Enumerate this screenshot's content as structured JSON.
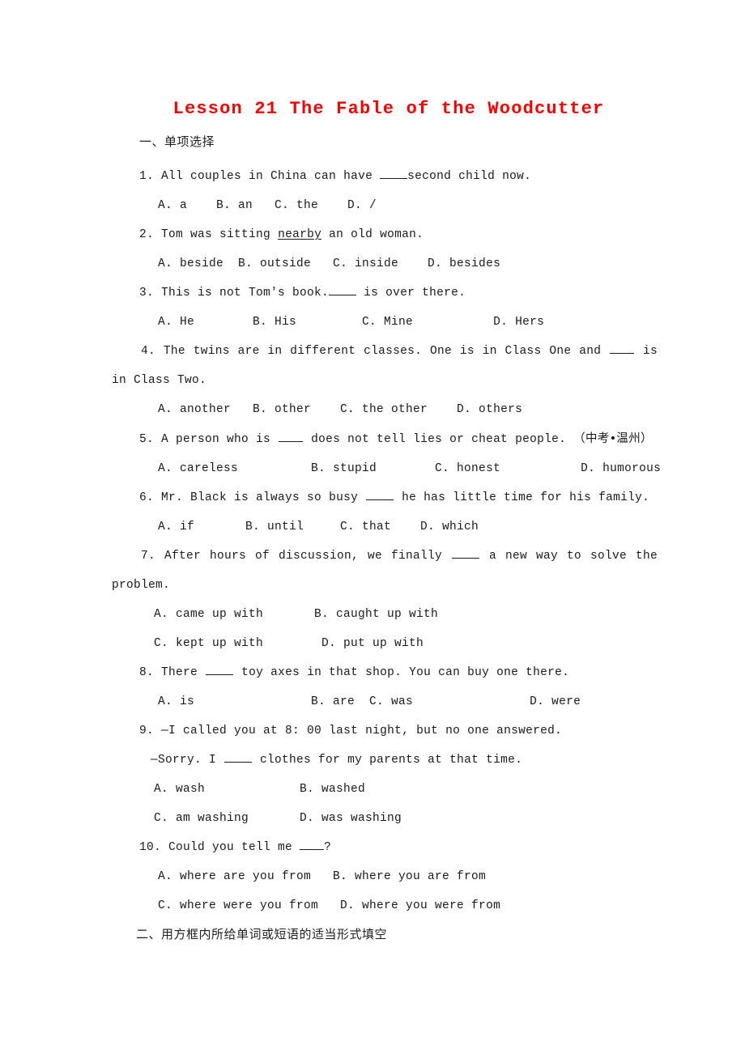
{
  "document": {
    "title": "Lesson 21 The Fable of the Woodcutter",
    "title_color": "#FF0000",
    "background_color": "#FFFFFF",
    "text_color": "#1A1A1A"
  },
  "sections": [
    {
      "id": "section-one",
      "heading": "一、单项选择"
    },
    {
      "id": "section-two",
      "heading": "二、用方框内所给单词或短语的适当形式填空"
    }
  ],
  "questions": [
    {
      "number": "1.",
      "stem_before": "All couples in China can have",
      "stem_after": "second child now.",
      "options_line1": "A. a    B. an   C. the    D. /",
      "options_line2": ""
    },
    {
      "number": "2.",
      "stem_before": "Tom was sitting",
      "underlined_word": "nearby",
      "stem_after": "an old woman.",
      "options_line1": "A. beside  B. outside   C. inside    D. besides",
      "options_line2": ""
    },
    {
      "number": "3.",
      "stem_before": "This is not Tom's book.",
      "stem_after": "is over there.",
      "options_line1": "A. He        B. His         C. Mine           D. Hers",
      "options_line2": ""
    },
    {
      "number": "4.",
      "stem_before": "The twins are in different classes. One is in Class One and",
      "stem_after": "is in Class Two.",
      "options_line1": "A. another   B. other    C. the other    D. others",
      "options_line2": ""
    },
    {
      "number": "5.",
      "stem_before": "A person who is",
      "stem_after": "does not tell lies or cheat people.",
      "annotation": "（中考•温州）",
      "options_line1": "A. careless          B. stupid        C. honest           D. humorous",
      "options_line2": ""
    },
    {
      "number": "6.",
      "stem_before": "Mr. Black is always so busy",
      "stem_after": "he has little time for his family.",
      "options_line1": "A. if       B. until     C. that    D. which",
      "options_line2": ""
    },
    {
      "number": "7.",
      "stem_before": "After hours of discussion, we finally",
      "stem_after": "a new way to solve the problem.",
      "options_line1": "A. came up with       B. caught up with",
      "options_line2": "C. kept up with        D. put up with"
    },
    {
      "number": "8.",
      "stem_before": "There",
      "stem_after": "toy axes in that shop. You can buy one there.",
      "options_line1": "A. is                B. are  C. was                D. were",
      "options_line2": ""
    },
    {
      "number": "9.",
      "stem_before": "—I called you at 8: 00 last night, but no one answered.",
      "reply_before": "—Sorry. I",
      "reply_after": "clothes for my parents at that time.",
      "options_line1": "A. wash             B. washed",
      "options_line2": "C. am washing       D. was washing"
    },
    {
      "number": "10.",
      "stem_before": "Could you tell me",
      "stem_after": "?",
      "options_line1": "A. where are you from   B. where you are from",
      "options_line2": "C. where were you from   D. where you were from"
    }
  ]
}
